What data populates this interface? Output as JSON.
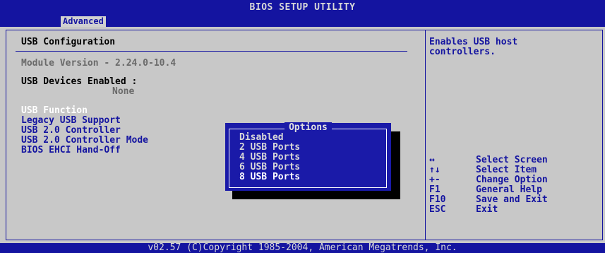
{
  "title": "BIOS SETUP UTILITY",
  "tab": "Advanced",
  "section_title": "USB Configuration",
  "module_version": "Module Version - 2.24.0-10.4",
  "usb_devices_label": "USB Devices Enabled :",
  "usb_devices_value": "None",
  "menu": [
    {
      "label": "USB Function"
    },
    {
      "label": "Legacy USB Support"
    },
    {
      "label": "USB 2.0 Controller"
    },
    {
      "label": "USB 2.0 Controller Mode"
    },
    {
      "label": "BIOS EHCI Hand-Off"
    }
  ],
  "help": {
    "line1": "Enables USB host",
    "line2": "controllers."
  },
  "keys": [
    {
      "key": "↔",
      "desc": "Select Screen"
    },
    {
      "key": "↑↓",
      "desc": "Select Item"
    },
    {
      "key": "+-",
      "desc": "Change Option"
    },
    {
      "key": "F1",
      "desc": "General Help"
    },
    {
      "key": "F10",
      "desc": "Save and Exit"
    },
    {
      "key": "ESC",
      "desc": "Exit"
    }
  ],
  "popup": {
    "title": "Options",
    "options": [
      "Disabled",
      "2 USB Ports",
      "4 USB Ports",
      "6 USB Ports",
      "8 USB Ports"
    ],
    "selected": "8 USB Ports"
  },
  "footer": "v02.57 (C)Copyright 1985-2004, American Megatrends, Inc.",
  "colors": {
    "bios_blue": "#1414a0",
    "panel_gray": "#c8c8c8",
    "dim_text": "#6a6a6a",
    "highlight_white": "#ffffff"
  }
}
